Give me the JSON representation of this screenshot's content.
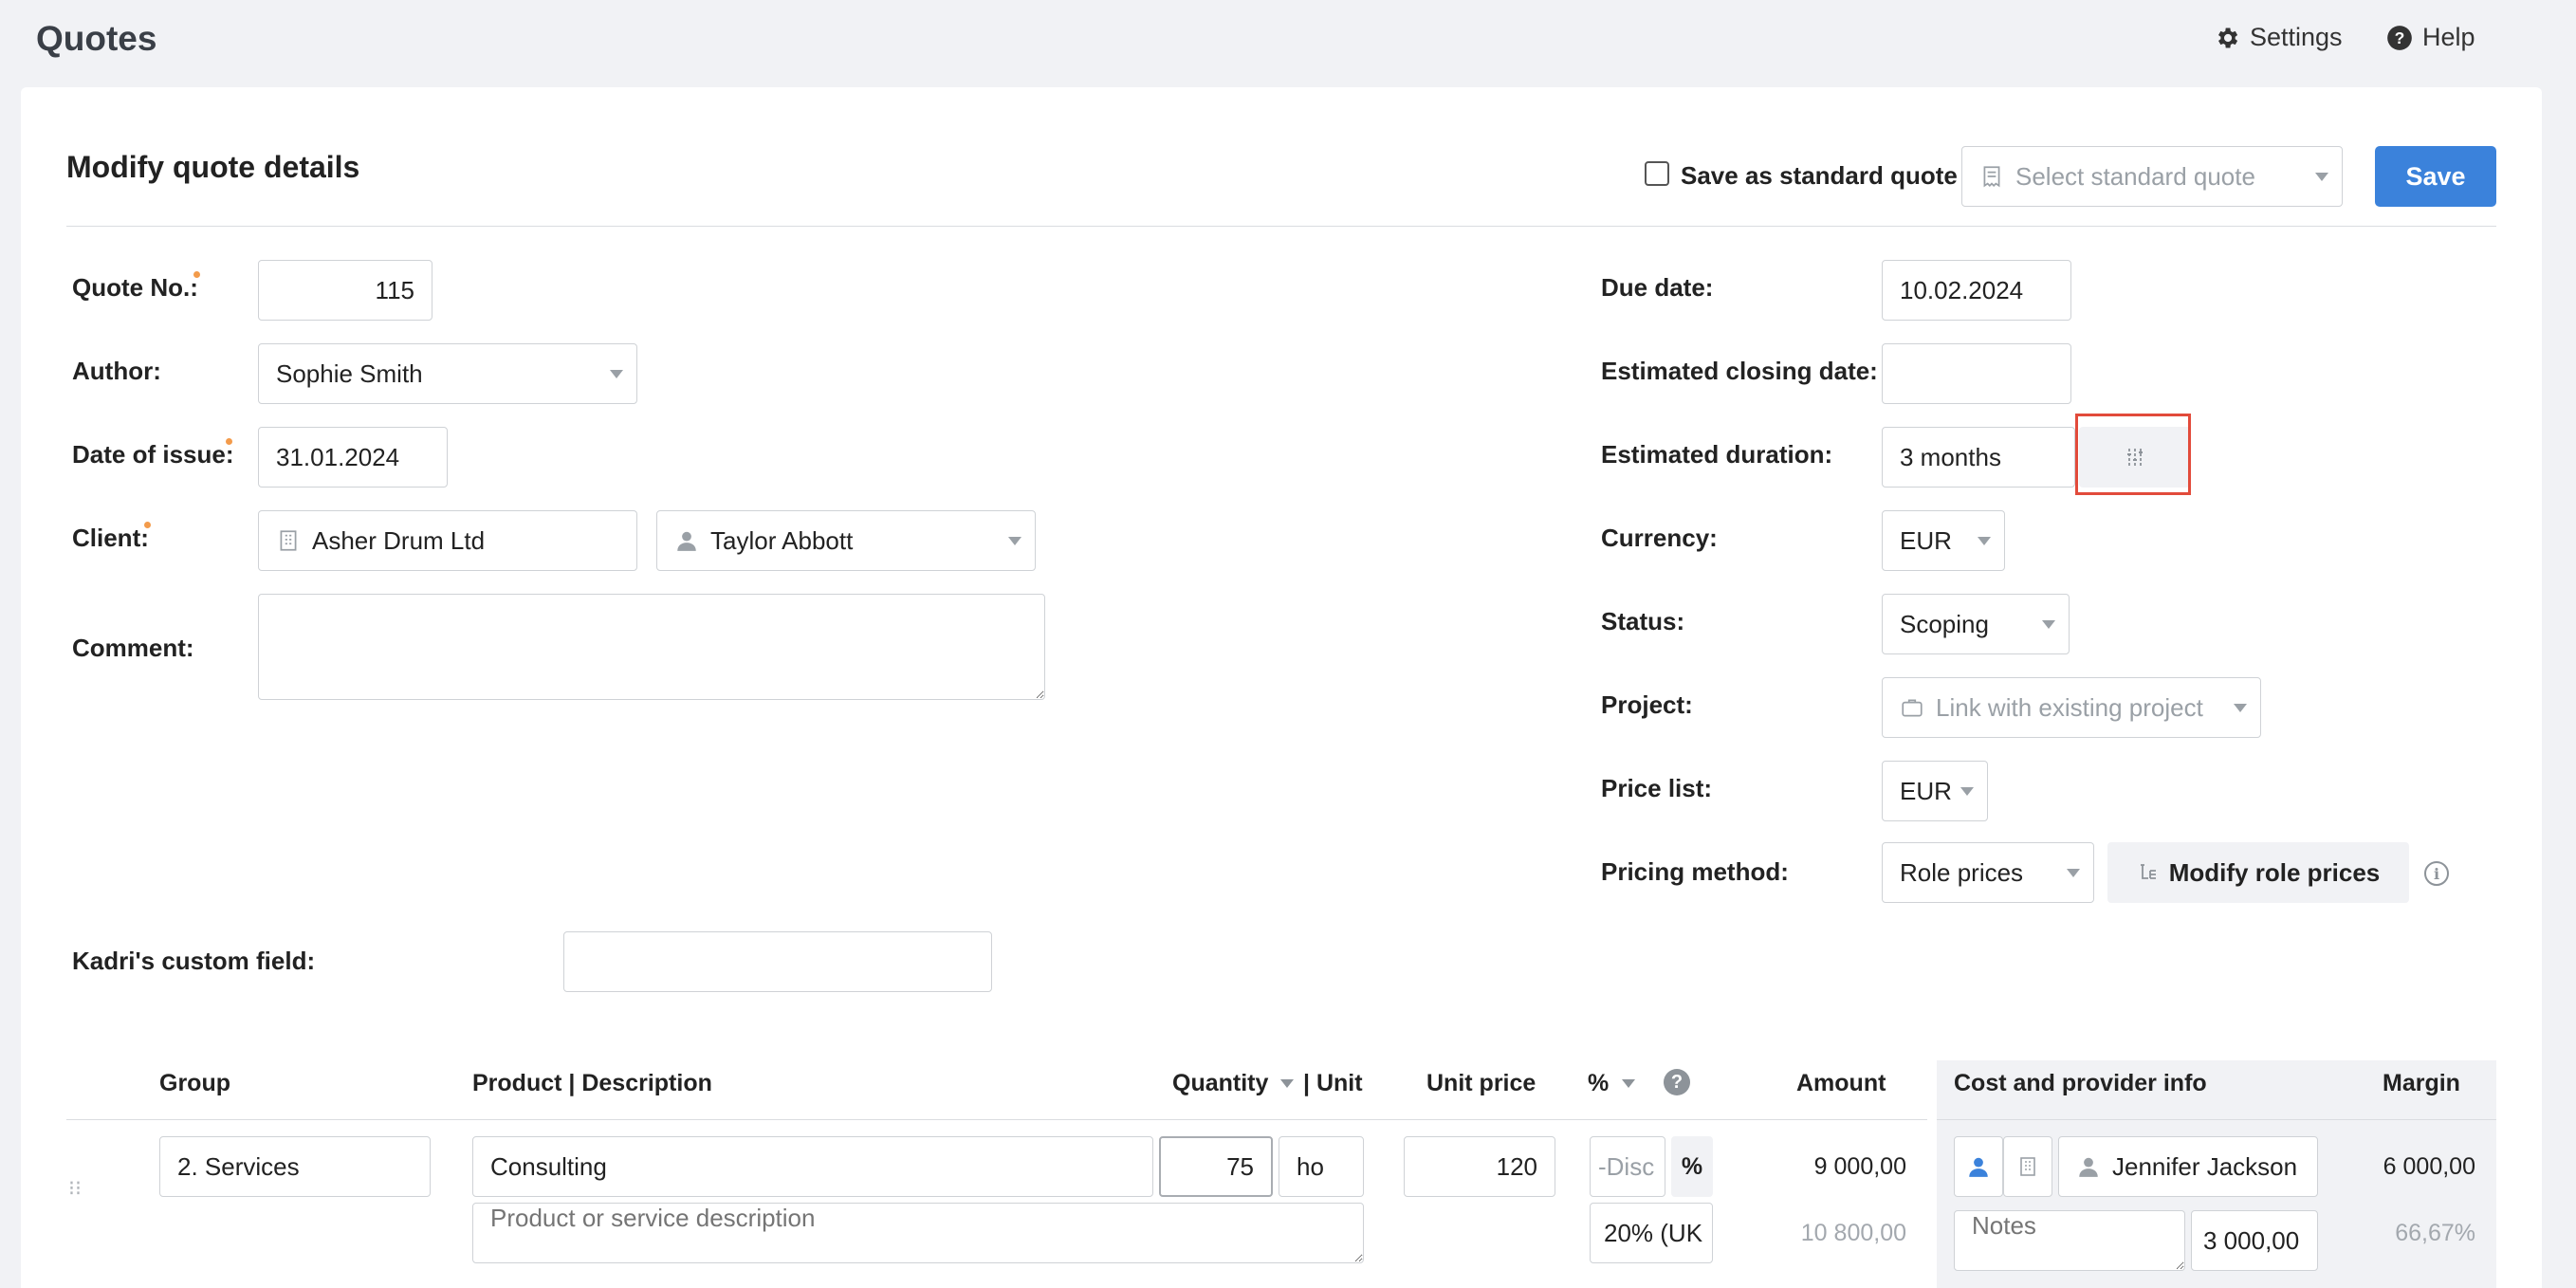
{
  "app": {
    "title": "Quotes",
    "settings_label": "Settings",
    "help_label": "Help"
  },
  "header": {
    "title": "Modify quote details",
    "save_standard_label": "Save as standard quote",
    "standard_quote_placeholder": "Select standard quote",
    "save_label": "Save"
  },
  "left_form": {
    "quote_no_label": "Quote No.:",
    "quote_no": "115",
    "author_label": "Author:",
    "author": "Sophie Smith",
    "date_issue_label": "Date of issue:",
    "date_issue": "31.01.2024",
    "client_label": "Client:",
    "client_company": "Asher Drum Ltd",
    "client_contact": "Taylor Abbott",
    "comment_label": "Comment:",
    "comment": "",
    "custom_field_label": "Kadri's custom field:",
    "custom_field": ""
  },
  "right_form": {
    "due_date_label": "Due date:",
    "due_date": "10.02.2024",
    "closing_date_label": "Estimated closing date:",
    "closing_date": "",
    "duration_label": "Estimated duration:",
    "duration": "3 months",
    "currency_label": "Currency:",
    "currency": "EUR",
    "status_label": "Status:",
    "status": "Scoping",
    "project_label": "Project:",
    "project_placeholder": "Link with existing project",
    "price_list_label": "Price list:",
    "price_list": "EUR",
    "pricing_method_label": "Pricing method:",
    "pricing_method": "Role prices",
    "modify_role_prices_label": "Modify role prices"
  },
  "table": {
    "headers": {
      "group": "Group",
      "product": "Product | Description",
      "quantity": "Quantity",
      "unit": "| Unit",
      "unit_price": "Unit price",
      "percent": "%",
      "amount": "Amount",
      "cost_info": "Cost and provider info",
      "margin": "Margin"
    },
    "rows": [
      {
        "group": "2. Services",
        "product": "Consulting",
        "description_placeholder": "Product or service description",
        "quantity": "75",
        "unit": "ho",
        "unit_price": "120",
        "discount_placeholder": "-Disc",
        "discount_unit": "%",
        "vat": "20% (UK",
        "amount": "9 000,00",
        "amount_with_vat": "10 800,00",
        "provider": "Jennifer Jackson",
        "notes_placeholder": "Notes",
        "cost": "3 000,00",
        "margin": "6 000,00",
        "margin_percent": "66,67%"
      }
    ]
  },
  "colors": {
    "accent": "#3b82db",
    "required": "#f39b4b",
    "highlight": "#e24b3b"
  }
}
